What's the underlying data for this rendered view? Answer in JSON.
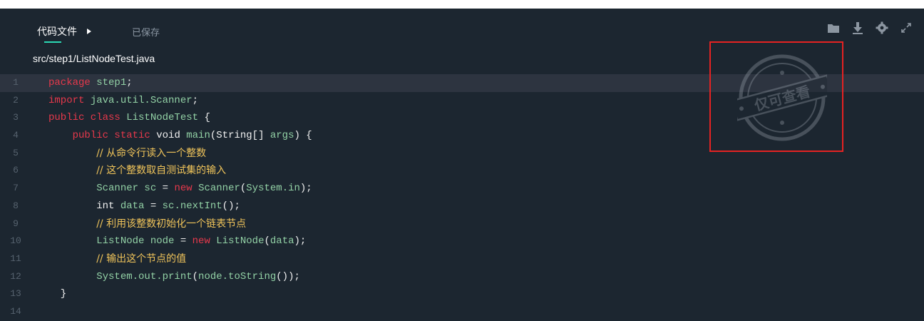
{
  "toolbar": {
    "tab_label": "代码文件",
    "saved_label": "已保存",
    "icons": [
      "folder-icon",
      "download-icon",
      "gear-icon",
      "expand-icon"
    ]
  },
  "file": {
    "path": "src/step1/ListNodeTest.java"
  },
  "editor": {
    "active_line": 1,
    "lines": [
      {
        "n": "1",
        "segs": [
          [
            "kw",
            "package "
          ],
          [
            "id",
            "step1"
          ],
          [
            "pl",
            ";"
          ]
        ]
      },
      {
        "n": "2",
        "segs": [
          [
            "kw",
            "import "
          ],
          [
            "id",
            "java.util.Scanner"
          ],
          [
            "pl",
            ";"
          ]
        ]
      },
      {
        "n": "3",
        "segs": [
          [
            "kw",
            "public class "
          ],
          [
            "id",
            "ListNodeTest "
          ],
          [
            "pl",
            "{"
          ]
        ]
      },
      {
        "n": "4",
        "segs": [
          [
            "pl",
            "    "
          ],
          [
            "kw",
            "public static "
          ],
          [
            "pl",
            "void "
          ],
          [
            "fn",
            "main"
          ],
          [
            "pl",
            "(String[] "
          ],
          [
            "id",
            "args"
          ],
          [
            "pl",
            ") {"
          ]
        ]
      },
      {
        "n": "5",
        "segs": [
          [
            "pl",
            "        "
          ],
          [
            "cm",
            "// 从命令行读入一个整数"
          ]
        ]
      },
      {
        "n": "6",
        "segs": [
          [
            "pl",
            "        "
          ],
          [
            "cm",
            "// 这个整数取自测试集的输入"
          ]
        ]
      },
      {
        "n": "7",
        "segs": [
          [
            "pl",
            "        "
          ],
          [
            "id",
            "Scanner sc "
          ],
          [
            "pl",
            "= "
          ],
          [
            "kw",
            "new "
          ],
          [
            "id",
            "Scanner"
          ],
          [
            "pl",
            "("
          ],
          [
            "id",
            "System.in"
          ],
          [
            "pl",
            ");"
          ]
        ]
      },
      {
        "n": "8",
        "segs": [
          [
            "pl",
            "        int "
          ],
          [
            "id",
            "data "
          ],
          [
            "pl",
            "= "
          ],
          [
            "id",
            "sc.nextInt"
          ],
          [
            "pl",
            "();"
          ]
        ]
      },
      {
        "n": "9",
        "segs": [
          [
            "pl",
            "        "
          ],
          [
            "cm",
            "// 利用该整数初始化一个链表节点"
          ]
        ]
      },
      {
        "n": "10",
        "segs": [
          [
            "pl",
            "        "
          ],
          [
            "id",
            "ListNode node "
          ],
          [
            "pl",
            "= "
          ],
          [
            "kw",
            "new "
          ],
          [
            "id",
            "ListNode"
          ],
          [
            "pl",
            "("
          ],
          [
            "id",
            "data"
          ],
          [
            "pl",
            ");"
          ]
        ]
      },
      {
        "n": "11",
        "segs": [
          [
            "pl",
            "        "
          ],
          [
            "cm",
            "// 输出这个节点的值"
          ]
        ]
      },
      {
        "n": "12",
        "segs": [
          [
            "pl",
            "        "
          ],
          [
            "id",
            "System.out.print"
          ],
          [
            "pl",
            "("
          ],
          [
            "id",
            "node.toString"
          ],
          [
            "pl",
            "());"
          ]
        ]
      },
      {
        "n": "13",
        "segs": [
          [
            "pl",
            "  }"
          ]
        ]
      },
      {
        "n": "14",
        "segs": []
      }
    ]
  },
  "watermark": {
    "text": "仅可查看",
    "color": "#9aa3ad"
  },
  "highlight_color": "#e52222",
  "accent_color": "#2bd9b4"
}
